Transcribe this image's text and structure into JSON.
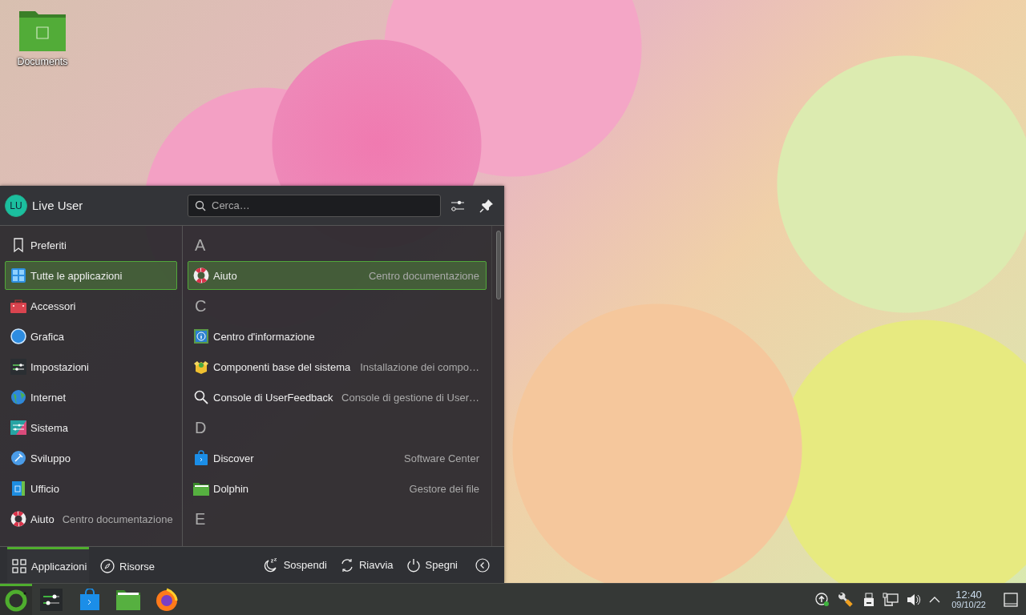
{
  "desktop_icons": [
    {
      "label": "Documents"
    }
  ],
  "menu": {
    "user": {
      "initials": "LU",
      "name": "Live User"
    },
    "search": {
      "placeholder": "Cerca…"
    },
    "categories": [
      {
        "label": "Preferiti",
        "selected": false
      },
      {
        "label": "Tutte le applicazioni",
        "selected": true
      },
      {
        "label": "Accessori",
        "selected": false
      },
      {
        "label": "Grafica",
        "selected": false
      },
      {
        "label": "Impostazioni",
        "selected": false
      },
      {
        "label": "Internet",
        "selected": false
      },
      {
        "label": "Sistema",
        "selected": false
      },
      {
        "label": "Sviluppo",
        "selected": false
      },
      {
        "label": "Ufficio",
        "selected": false
      },
      {
        "label": "Aiuto",
        "description": "Centro documentazione",
        "selected": false
      }
    ],
    "sections": [
      {
        "letter": "A",
        "items": [
          {
            "name": "Aiuto",
            "description": "Centro documentazione",
            "selected": true
          }
        ]
      },
      {
        "letter": "C",
        "items": [
          {
            "name": "Centro d'informazione",
            "selected": false
          },
          {
            "name": "Componenti base del sistema",
            "description": "Installazione dei compo…",
            "selected": false
          },
          {
            "name": "Console di UserFeedback",
            "description": "Console di gestione di User…",
            "selected": false
          }
        ]
      },
      {
        "letter": "D",
        "items": [
          {
            "name": "Discover",
            "description": "Software Center",
            "selected": false
          },
          {
            "name": "Dolphin",
            "description": "Gestore dei file",
            "selected": false
          }
        ]
      },
      {
        "letter": "E"
      }
    ],
    "tabs": [
      {
        "label": "Applicazioni",
        "selected": true
      },
      {
        "label": "Risorse",
        "selected": false
      }
    ],
    "power": [
      {
        "label": "Sospendi"
      },
      {
        "label": "Riavvia"
      },
      {
        "label": "Spegni"
      }
    ]
  },
  "taskbar": {
    "clock": {
      "time": "12:40",
      "date": "09/10/22"
    }
  }
}
